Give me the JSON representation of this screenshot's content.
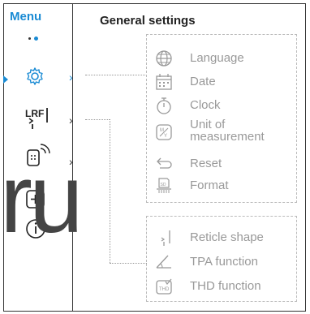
{
  "header": {
    "menu_label": "Menu",
    "settings_title": "General settings"
  },
  "sidebar": {
    "items": [
      {
        "icon": "gear-icon",
        "chevron": "›",
        "active": true
      },
      {
        "icon": "lrf-icon",
        "label": "LRF",
        "chevron": "›"
      },
      {
        "icon": "wireless-icon",
        "chevron": "›"
      },
      {
        "icon": "plus-icon",
        "chevron": "›"
      },
      {
        "icon": "info-icon"
      }
    ]
  },
  "general_settings": [
    {
      "icon": "globe-icon",
      "label": "Language"
    },
    {
      "icon": "calendar-icon",
      "label": "Date"
    },
    {
      "icon": "stopwatch-icon",
      "label": "Clock"
    },
    {
      "icon": "units-icon",
      "label": "Unit of\nmeasurement"
    },
    {
      "icon": "reset-arrow-icon",
      "label": "Reset"
    },
    {
      "icon": "sd-card-icon",
      "label": "Format"
    }
  ],
  "lrf_settings": [
    {
      "icon": "reticle-icon",
      "label": "Reticle shape"
    },
    {
      "icon": "angle-icon",
      "label": "TPA function"
    },
    {
      "icon": "thd-icon",
      "label": "THD function"
    }
  ],
  "watermark": "ru",
  "colors": {
    "accent": "#1a8bd4",
    "muted": "#999999",
    "border": "#333333"
  }
}
